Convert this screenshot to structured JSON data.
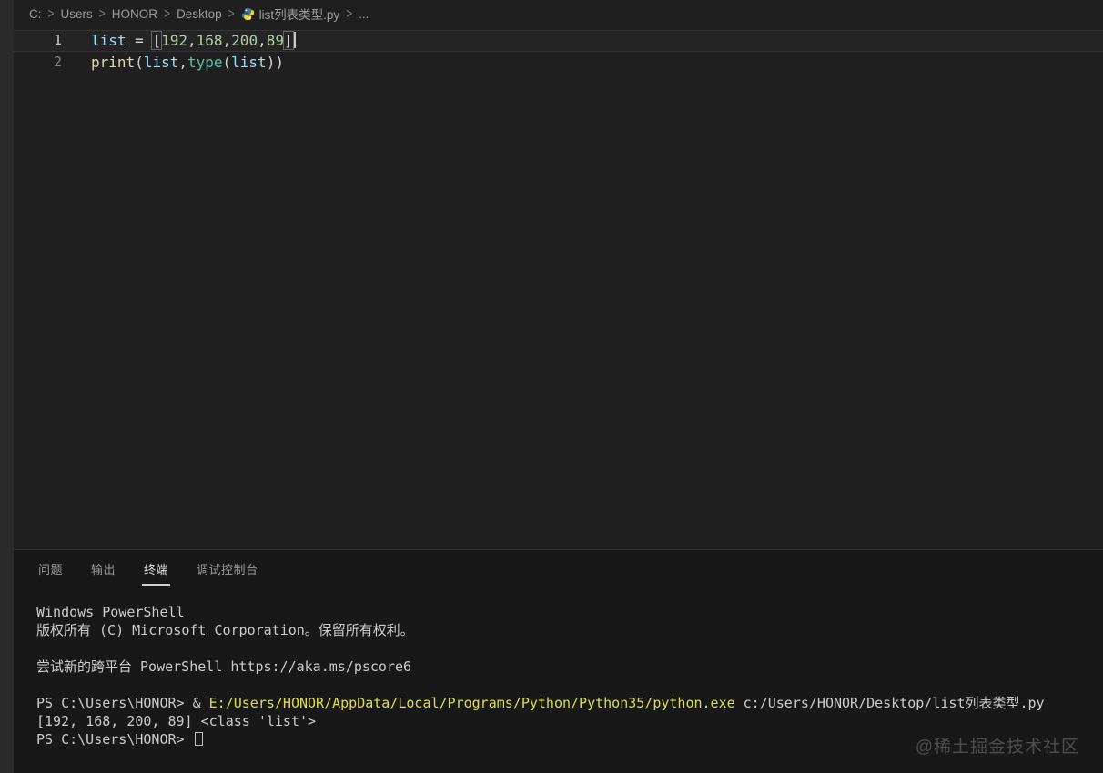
{
  "breadcrumb": {
    "segments": [
      "C:",
      "Users",
      "HONOR",
      "Desktop"
    ],
    "file": "list列表类型.py",
    "file_icon": "python-icon",
    "overflow": "..."
  },
  "editor": {
    "lines": [
      {
        "number": "1",
        "active": true,
        "tokens": [
          {
            "t": "var",
            "s": "list"
          },
          {
            "t": "op",
            "s": " = "
          },
          {
            "t": "bm",
            "s": "["
          },
          {
            "t": "num",
            "s": "192"
          },
          {
            "t": "op",
            "s": ","
          },
          {
            "t": "num",
            "s": "168"
          },
          {
            "t": "op",
            "s": ","
          },
          {
            "t": "num",
            "s": "200"
          },
          {
            "t": "op",
            "s": ","
          },
          {
            "t": "num",
            "s": "89"
          },
          {
            "t": "bm",
            "s": "]"
          },
          {
            "t": "cursor",
            "s": ""
          }
        ]
      },
      {
        "number": "2",
        "active": false,
        "tokens": [
          {
            "t": "fn",
            "s": "print"
          },
          {
            "t": "op",
            "s": "("
          },
          {
            "t": "var",
            "s": "list"
          },
          {
            "t": "op",
            "s": ","
          },
          {
            "t": "type",
            "s": "type"
          },
          {
            "t": "op",
            "s": "("
          },
          {
            "t": "var",
            "s": "list"
          },
          {
            "t": "op",
            "s": "))"
          }
        ]
      }
    ]
  },
  "panel": {
    "tabs": [
      {
        "label": "问题",
        "active": false
      },
      {
        "label": "输出",
        "active": false
      },
      {
        "label": "终端",
        "active": true
      },
      {
        "label": "调试控制台",
        "active": false
      }
    ]
  },
  "terminal": {
    "lines": [
      {
        "segments": [
          {
            "c": "fg",
            "s": "Windows PowerShell"
          }
        ]
      },
      {
        "segments": [
          {
            "c": "fg",
            "s": "版权所有 (C) Microsoft Corporation。保留所有权利。"
          }
        ]
      },
      {
        "segments": []
      },
      {
        "segments": [
          {
            "c": "fg",
            "s": "尝试新的跨平台 PowerShell https://aka.ms/pscore6"
          }
        ]
      },
      {
        "segments": []
      },
      {
        "segments": [
          {
            "c": "fg",
            "s": "PS C:\\Users\\HONOR> & "
          },
          {
            "c": "path",
            "s": "E:/Users/HONOR/AppData/Local/Programs/Python/Python35/python.exe"
          },
          {
            "c": "fg",
            "s": " c:/Users/HONOR/Desktop/list列表类型.py"
          }
        ]
      },
      {
        "segments": [
          {
            "c": "fg",
            "s": "[192, 168, 200, 89] <class 'list'>"
          }
        ]
      },
      {
        "segments": [
          {
            "c": "fg",
            "s": "PS C:\\Users\\HONOR> "
          },
          {
            "c": "cursor",
            "s": ""
          }
        ]
      }
    ]
  },
  "watermark": "@稀土掘金技术社区",
  "colors": {
    "editor_bg": "#1f1f1f",
    "panel_bg": "#181818",
    "window_edge": "#2b2b2b",
    "variable": "#9cdcfe",
    "number": "#b5cea8",
    "function": "#dcdcaa",
    "type": "#4ec9b0",
    "operator": "#d4d4d4",
    "terminal_fg": "#cccccc",
    "terminal_path_yellow": "#dede50",
    "tab_active_fg": "#e7e7e7",
    "tab_inactive_fg": "#9a9a9a",
    "breadcrumb_fg": "#9d9d9d",
    "python_icon_blue": "#3b77a8",
    "python_icon_yellow": "#f2d336"
  }
}
